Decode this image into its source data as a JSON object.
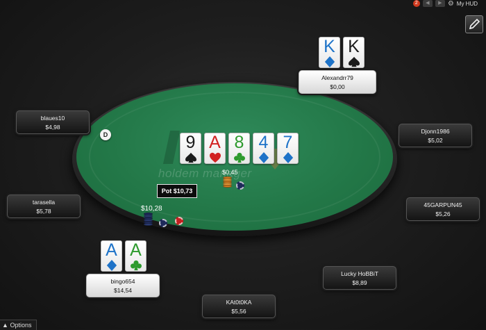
{
  "topbar": {
    "badge": "2",
    "hud_label": "My HUD",
    "icons": [
      "prev-arrow-icon",
      "next-arrow-icon",
      "gear-icon"
    ]
  },
  "table": {
    "watermark": "holdem manager",
    "felt_color": "#237848"
  },
  "board": [
    {
      "rank": "9",
      "suit": "spade"
    },
    {
      "rank": "A",
      "suit": "heart"
    },
    {
      "rank": "8",
      "suit": "club"
    },
    {
      "rank": "4",
      "suit": "diamond"
    },
    {
      "rank": "7",
      "suit": "diamond"
    }
  ],
  "pot": {
    "label": "Pot $10,73"
  },
  "bets": {
    "top": "$0,45",
    "hero": "$10,28"
  },
  "dealer_button": "D",
  "seats": [
    {
      "id": "alexandrr79",
      "name": "Alexandrr79",
      "stack": "$0,00",
      "hero": true,
      "cards": [
        {
          "rank": "K",
          "suit": "diamond"
        },
        {
          "rank": "K",
          "suit": "spade"
        }
      ]
    },
    {
      "id": "blaues10",
      "name": "blaues10",
      "stack": "$4,98"
    },
    {
      "id": "djonn1986",
      "name": "Djonn1986",
      "stack": "$5,02"
    },
    {
      "id": "tarasella",
      "name": "tarasella",
      "stack": "$5,78"
    },
    {
      "id": "45garpun45",
      "name": "45GARPUN45",
      "stack": "$5,26"
    },
    {
      "id": "bingo654",
      "name": "bingo654",
      "stack": "$14,54",
      "hero": true,
      "cards": [
        {
          "rank": "A",
          "suit": "diamond"
        },
        {
          "rank": "A",
          "suit": "club"
        }
      ]
    },
    {
      "id": "lucky-hobbit",
      "name": "Lucky HoBBiT",
      "stack": "$8,89"
    },
    {
      "id": "kat0t0ka",
      "name": "KAt0t0KA",
      "stack": "$5,56"
    }
  ],
  "options_label": "Options",
  "colors": {
    "spade": "#1a1a1a",
    "heart": "#d22222",
    "club": "#2d9a2d",
    "diamond": "#1e73c8",
    "chip_navy": "#1e2a5a",
    "chip_red": "#c42020",
    "chip_orange": "#d07a20"
  }
}
